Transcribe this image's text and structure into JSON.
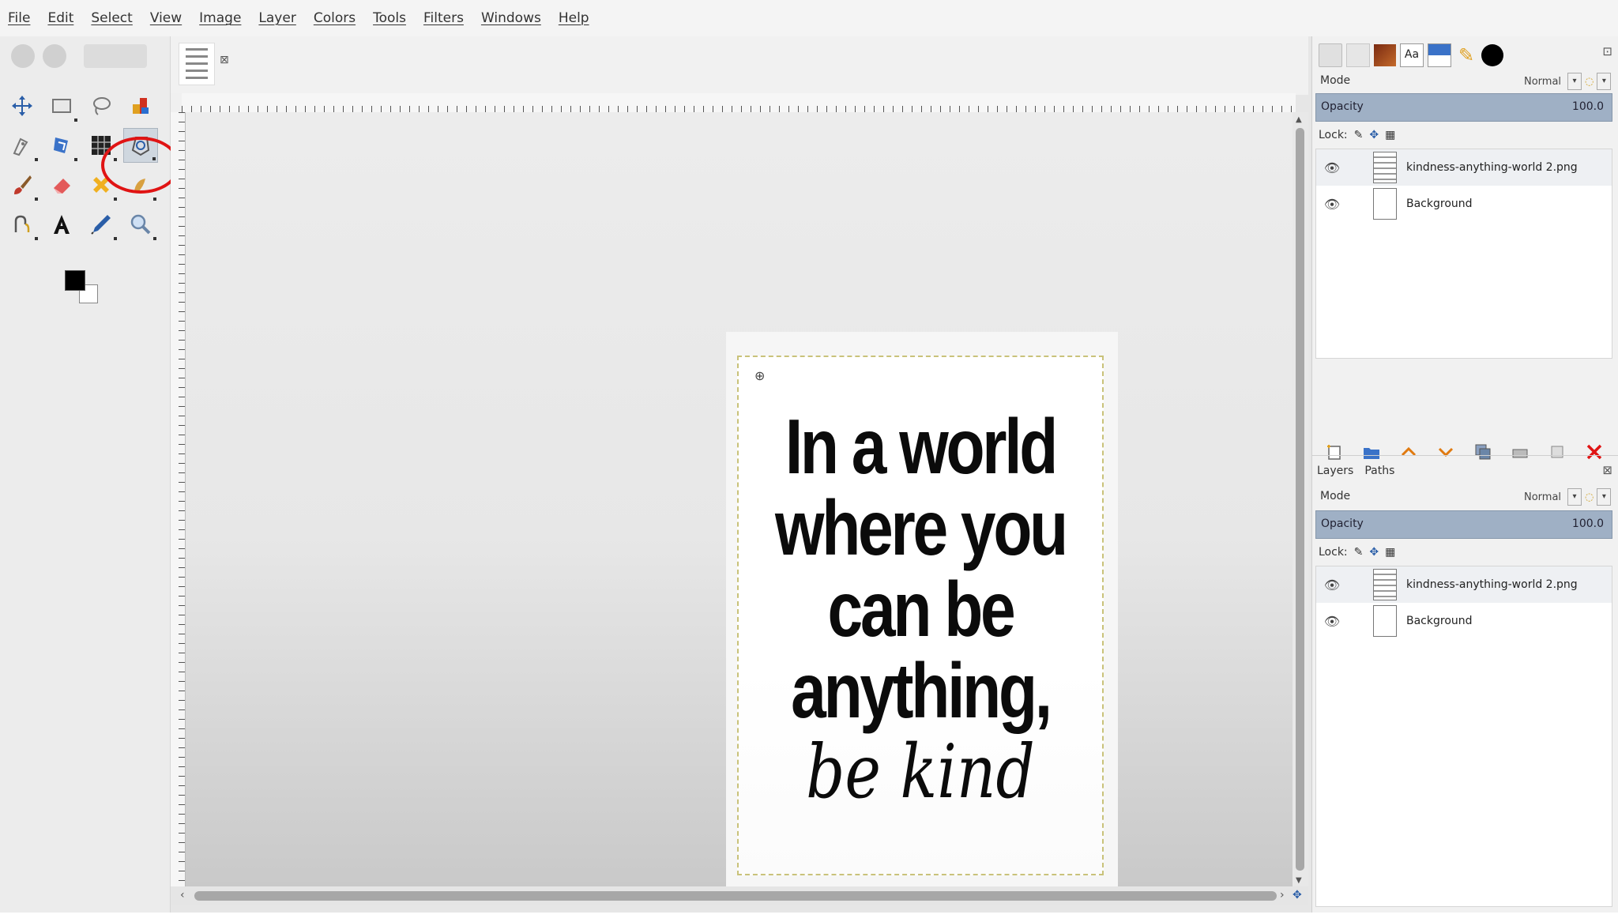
{
  "menubar": {
    "items": [
      "File",
      "Edit",
      "Select",
      "View",
      "Image",
      "Layer",
      "Colors",
      "Tools",
      "Filters",
      "Windows",
      "Help"
    ]
  },
  "toolbox": {
    "tools": [
      "move-tool",
      "rect-select-tool",
      "free-select-tool",
      "fuzzy-select-tool",
      "paths-tool",
      "unified-transform-tool",
      "warp-tool",
      "cage-transform-tool",
      "paintbrush-tool",
      "eraser-tool",
      "heal-tool",
      "smudge-tool",
      "dodge-burn-tool",
      "text-tool",
      "color-picker-tool",
      "zoom-tool"
    ],
    "active_tool": "cage-transform-tool",
    "foreground_color": "#000000",
    "background_color": "#ffffff",
    "highlight_color": "#e01414"
  },
  "canvas": {
    "quote_lines": [
      "In a world",
      "where you",
      "can be",
      "anything,"
    ],
    "quote_italic": "be kind"
  },
  "layers_panel_top": {
    "mode_label": "Mode",
    "mode_value": "Normal",
    "opacity_label": "Opacity",
    "opacity_value": "100.0",
    "lock_label": "Lock:",
    "layers": [
      {
        "name": "kindness-anything-world 2.png",
        "visible": true,
        "thumb": "text"
      },
      {
        "name": "Background",
        "visible": true,
        "thumb": "blank"
      }
    ]
  },
  "layers_panel_bottom": {
    "tabs": [
      "Layers",
      "Paths"
    ],
    "mode_label": "Mode",
    "mode_value": "Normal",
    "opacity_label": "Opacity",
    "opacity_value": "100.0",
    "lock_label": "Lock:",
    "layers": [
      {
        "name": "kindness-anything-world 2.png",
        "visible": true,
        "thumb": "text"
      },
      {
        "name": "Background",
        "visible": true,
        "thumb": "blank"
      }
    ]
  },
  "colors": {
    "accent_selection": "#9fb0c5",
    "delete_red": "#e01414",
    "arrow_orange": "#e07a10"
  }
}
